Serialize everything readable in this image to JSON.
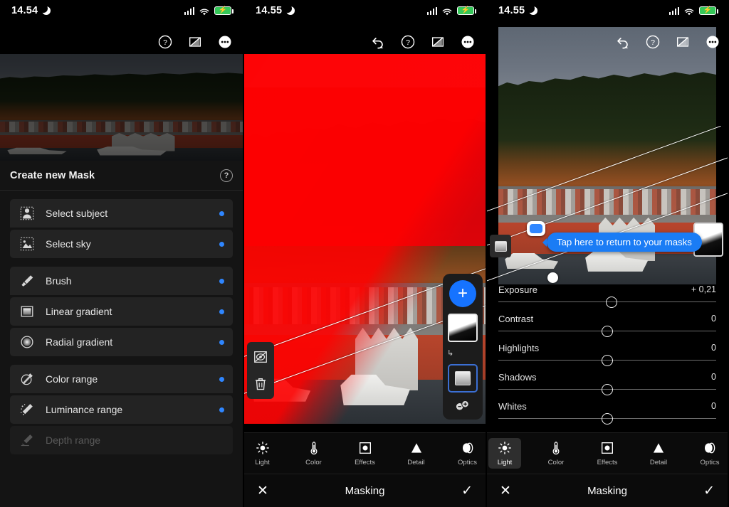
{
  "app": {
    "title": "Masking",
    "accent": "#2f86ff",
    "mask_overlay_color": "#e6000a"
  },
  "panels": [
    {
      "status": {
        "time": "14.54",
        "moon_icon": "moon-icon",
        "signal_icon": "signal-bars-icon",
        "wifi_icon": "wifi-icon",
        "battery_icon": "battery-charging-icon"
      },
      "top_tools": [
        {
          "name": "help-icon",
          "glyph": "?"
        },
        {
          "name": "compare-original-icon",
          "glyph": "eye-slash"
        },
        {
          "name": "more-options-icon",
          "glyph": "ellipsis"
        }
      ],
      "sheet": {
        "title": "Create new Mask",
        "help_icon": "help-icon",
        "groups": [
          {
            "items": [
              {
                "label": "Select subject",
                "icon": "select-subject-icon",
                "dot": true,
                "disabled": false
              },
              {
                "label": "Select sky",
                "icon": "select-sky-icon",
                "dot": true,
                "disabled": false
              }
            ]
          },
          {
            "items": [
              {
                "label": "Brush",
                "icon": "brush-icon",
                "dot": true,
                "disabled": false
              },
              {
                "label": "Linear gradient",
                "icon": "linear-gradient-icon",
                "dot": true,
                "disabled": false
              },
              {
                "label": "Radial gradient",
                "icon": "radial-gradient-icon",
                "dot": true,
                "disabled": false
              }
            ]
          },
          {
            "items": [
              {
                "label": "Color range",
                "icon": "color-range-icon",
                "dot": true,
                "disabled": false
              },
              {
                "label": "Luminance range",
                "icon": "luminance-range-icon",
                "dot": true,
                "disabled": false
              },
              {
                "label": "Depth range",
                "icon": "depth-range-icon",
                "dot": false,
                "disabled": true
              }
            ]
          }
        ]
      }
    },
    {
      "status": {
        "time": "14.55",
        "moon_icon": "moon-icon",
        "signal_icon": "signal-bars-icon",
        "wifi_icon": "wifi-icon",
        "battery_icon": "battery-charging-icon"
      },
      "top_tools": [
        {
          "name": "undo-icon",
          "glyph": "undo"
        },
        {
          "name": "help-icon",
          "glyph": "?"
        },
        {
          "name": "compare-original-icon",
          "glyph": "eye-slash"
        },
        {
          "name": "more-options-icon",
          "glyph": "ellipsis"
        }
      ],
      "mask_rail": {
        "add_mask_label": "+",
        "mask_thumbnail": "linear-gradient-mask-thumbnail",
        "sub_mask": "linear-gradient-submask",
        "add_subtract": "add-subtract-icon"
      },
      "left_rail": [
        {
          "name": "invert-mask-icon"
        },
        {
          "name": "delete-mask-icon"
        }
      ],
      "tools": [
        {
          "label": "Light",
          "icon": "light-icon",
          "active": false
        },
        {
          "label": "Color",
          "icon": "color-icon",
          "active": false
        },
        {
          "label": "Effects",
          "icon": "effects-icon",
          "active": false
        },
        {
          "label": "Detail",
          "icon": "detail-icon",
          "active": false
        },
        {
          "label": "Optics",
          "icon": "optics-icon",
          "active": false
        }
      ],
      "bottom": {
        "cancel_icon": "close-icon",
        "title": "Masking",
        "confirm_icon": "check-icon"
      }
    },
    {
      "status": {
        "time": "14.55",
        "moon_icon": "moon-icon",
        "signal_icon": "signal-bars-icon",
        "wifi_icon": "wifi-icon",
        "battery_icon": "battery-charging-icon"
      },
      "top_tools": [
        {
          "name": "undo-icon",
          "glyph": "undo"
        },
        {
          "name": "help-icon",
          "glyph": "?"
        },
        {
          "name": "compare-original-icon",
          "glyph": "eye-slash"
        },
        {
          "name": "more-options-icon",
          "glyph": "ellipsis"
        }
      ],
      "tooltip": {
        "text": "Tap here to return to your masks"
      },
      "mask_chip": "masks-toggle-chip",
      "mask_thumbnail": "linear-gradient-mask-thumbnail",
      "mask_type_badge": "linear-gradient-icon",
      "sliders": [
        {
          "label": "Exposure",
          "value": "+ 0,21",
          "pos": 52
        },
        {
          "label": "Contrast",
          "value": "0",
          "pos": 50
        },
        {
          "label": "Highlights",
          "value": "0",
          "pos": 50
        },
        {
          "label": "Shadows",
          "value": "0",
          "pos": 50
        },
        {
          "label": "Whites",
          "value": "0",
          "pos": 50
        }
      ],
      "tools": [
        {
          "label": "Light",
          "icon": "light-icon",
          "active": true
        },
        {
          "label": "Color",
          "icon": "color-icon",
          "active": false
        },
        {
          "label": "Effects",
          "icon": "effects-icon",
          "active": false
        },
        {
          "label": "Detail",
          "icon": "detail-icon",
          "active": false
        },
        {
          "label": "Optics",
          "icon": "optics-icon",
          "active": false
        }
      ],
      "bottom": {
        "cancel_icon": "close-icon",
        "title": "Masking",
        "confirm_icon": "check-icon"
      }
    }
  ]
}
